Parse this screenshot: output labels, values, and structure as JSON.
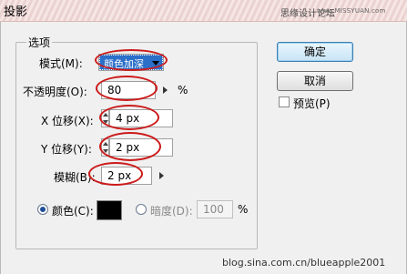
{
  "window": {
    "title": "投影",
    "watermark_site": "思缘设计论坛",
    "watermark_url": "www.MISSYUAN.com"
  },
  "group": {
    "legend": "选项"
  },
  "mode": {
    "label": "模式(M):",
    "value": "颜色加深"
  },
  "opacity": {
    "label": "不透明度(O):",
    "value": "80",
    "unit": "%"
  },
  "x_offset": {
    "label": "X 位移(X):",
    "value": "4 px"
  },
  "y_offset": {
    "label": "Y 位移(Y):",
    "value": "2 px"
  },
  "blur": {
    "label": "模糊(B):",
    "value": "2 px"
  },
  "color_option": {
    "label": "颜色(C):",
    "selected": true,
    "swatch_color": "#000000"
  },
  "darkness_option": {
    "label": "暗度(D):",
    "value": "100",
    "unit": "%",
    "selected": false
  },
  "buttons": {
    "ok": "确定",
    "cancel": "取消"
  },
  "preview": {
    "label": "预览(P)",
    "checked": false
  },
  "annotation_color": "#cc1a1a",
  "bottom_watermark": "blog.sina.com.cn/blueapple2001"
}
